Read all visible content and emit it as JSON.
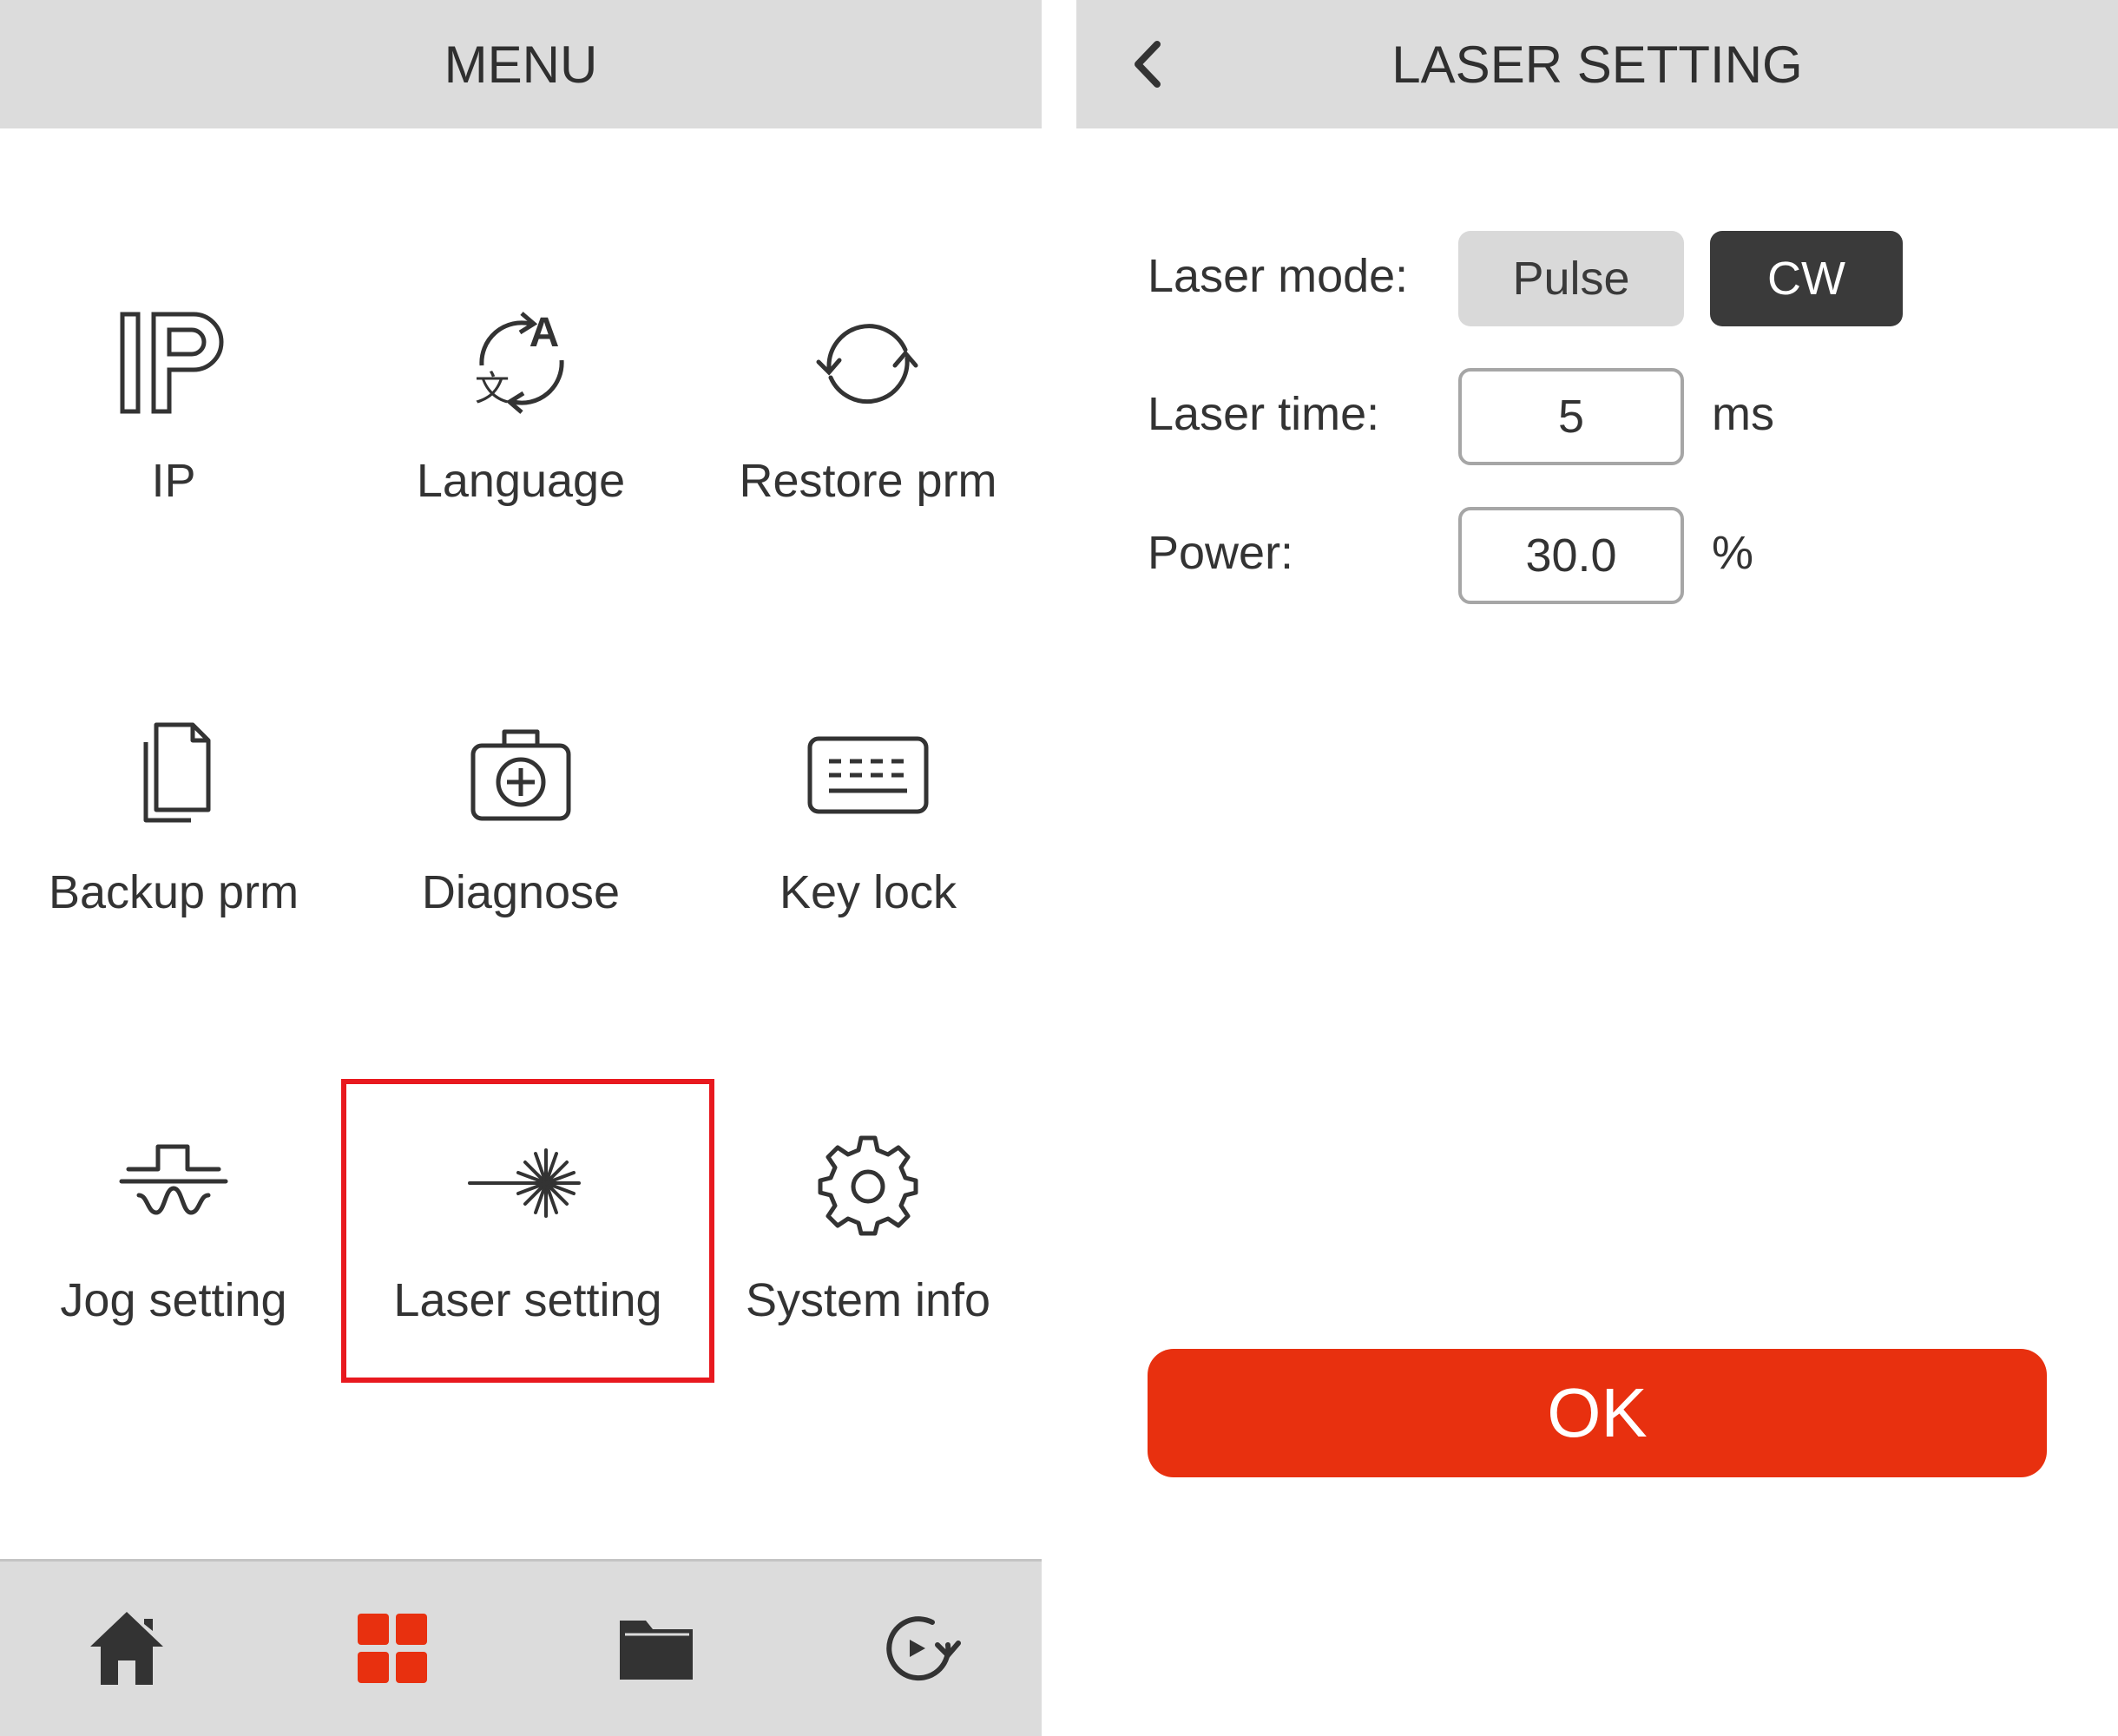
{
  "menu_screen": {
    "title": "MENU",
    "items": [
      {
        "label": "IP",
        "icon": "ip-icon"
      },
      {
        "label": "Language",
        "icon": "language-icon"
      },
      {
        "label": "Restore prm",
        "icon": "restore-icon"
      },
      {
        "label": "Backup prm",
        "icon": "backup-icon"
      },
      {
        "label": "Diagnose",
        "icon": "diagnose-icon"
      },
      {
        "label": "Key lock",
        "icon": "keyboard-icon"
      },
      {
        "label": "Jog setting",
        "icon": "jog-icon"
      },
      {
        "label": "Laser setting",
        "icon": "laser-icon",
        "selected": true
      },
      {
        "label": "System info",
        "icon": "gear-icon"
      }
    ],
    "bottom_nav": [
      {
        "icon": "home-icon",
        "active": false
      },
      {
        "icon": "grid-icon",
        "active": true
      },
      {
        "icon": "folder-icon",
        "active": false
      },
      {
        "icon": "refresh-icon",
        "active": false
      }
    ],
    "highlight_color": "#e8191f",
    "active_color": "#e8300f"
  },
  "laser_screen": {
    "title": "LASER SETTING",
    "laser_mode": {
      "label": "Laser mode:",
      "options": [
        "Pulse",
        "CW"
      ],
      "selected": "CW"
    },
    "laser_time": {
      "label": "Laser time:",
      "value": "5",
      "unit": "ms"
    },
    "power": {
      "label": "Power:",
      "value": "30.0",
      "unit": "%"
    },
    "ok_label": "OK",
    "ok_color": "#e8300f"
  }
}
